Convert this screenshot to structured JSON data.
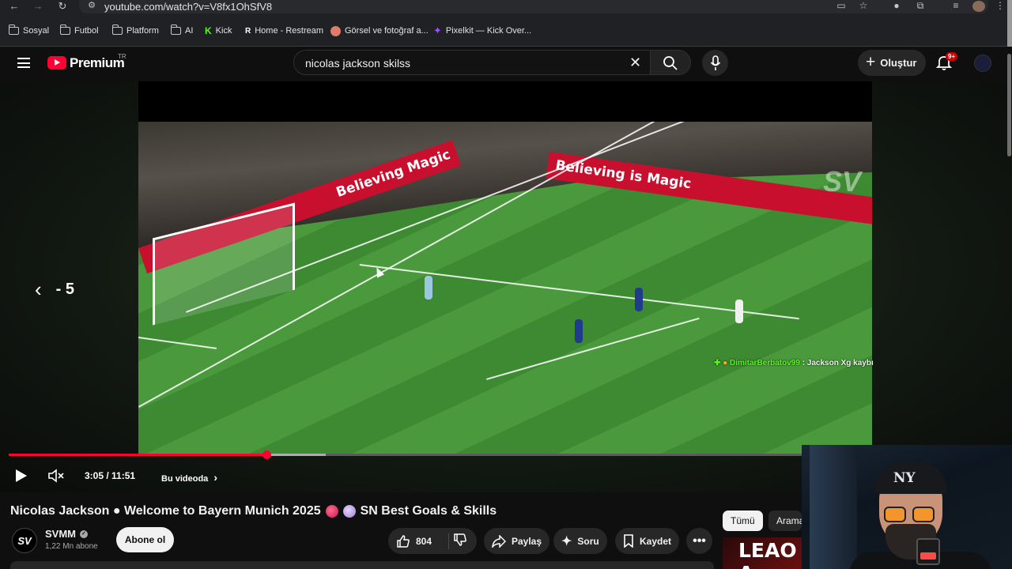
{
  "browser": {
    "url": "youtube.com/watch?v=V8fx1OhSfV8",
    "bookmarks": [
      {
        "label": "Sosyal",
        "icon": "folder-icon"
      },
      {
        "label": "Futbol",
        "icon": "folder-icon"
      },
      {
        "label": "Platform",
        "icon": "folder-icon"
      },
      {
        "label": "AI",
        "icon": "folder-icon"
      },
      {
        "label": "Kick",
        "icon": "kick-icon"
      },
      {
        "label": "Home - Restream",
        "icon": "restream-icon"
      },
      {
        "label": "Görsel ve fotoğraf a...",
        "icon": "image-site-icon"
      },
      {
        "label": "Pixelkit — Kick Over...",
        "icon": "pixelkit-icon"
      }
    ]
  },
  "header": {
    "logo_text": "Premium",
    "logo_region": "TR",
    "search_value": "nicolas jackson skilss",
    "create_label": "Oluştur",
    "notifications_badge": "9+"
  },
  "player": {
    "seek_indicator": "- 5",
    "time_display": "3:05 / 11:51",
    "chapter_label": "Bu videoda",
    "progress_fraction": 0.325,
    "buffered_fraction": 0.4,
    "billboard_1": "Believing is Magic",
    "billboard_2": "Believing",
    "billboard_3": "Magic",
    "watermark": "SV",
    "chat_overlay": {
      "user": "DimitarBerbatov99",
      "message": " : Jackson Xg kaybı"
    }
  },
  "video": {
    "title_part1": "Nicolas Jackson ● Welcome to Bayern Munich 2025",
    "title_part2": "SN Best Goals & Skills",
    "channel_name": "SVMM",
    "channel_avatar_text": "SV",
    "subscribers": "1,22 Mn abone",
    "subscribe_label": "Abone ol",
    "like_count": "804",
    "share_label": "Paylaş",
    "ask_label": "Soru",
    "save_label": "Kaydet"
  },
  "sidebar": {
    "chips": [
      "Tümü",
      "Arama"
    ],
    "thumbnail_text": "LEAO A"
  },
  "webcam": {
    "cap_logo": "NY"
  },
  "colors": {
    "accent": "#ff0033",
    "background": "#0f0f0f",
    "chat_user": "#53fc18"
  }
}
